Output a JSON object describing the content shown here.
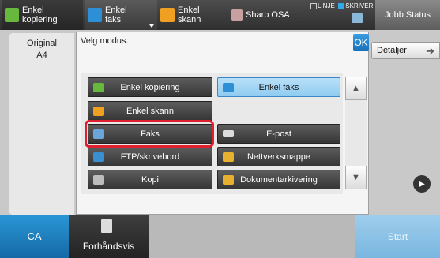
{
  "tabs": [
    {
      "label": "Enkel kopiering",
      "line1": "Enkel",
      "line2": "kopiering",
      "icon": "copy-icon"
    },
    {
      "label": "Enkel faks",
      "line1": "Enkel",
      "line2": "faks",
      "icon": "fax-icon"
    },
    {
      "label": "Enkel skann",
      "line1": "Enkel",
      "line2": "skann",
      "icon": "scan-icon"
    },
    {
      "label": "Sharp OSA",
      "line1": "Sharp OSA",
      "icon": "osa-icon"
    }
  ],
  "status": {
    "line": "LINJE",
    "printer": "SKRIVER"
  },
  "job_status": "Jobb Status",
  "original": {
    "label": "Original",
    "size": "A4"
  },
  "detail_button": "Detaljer",
  "dialog": {
    "title": "Velg modus.",
    "ok": "OK"
  },
  "modes": [
    {
      "label": "Enkel kopiering",
      "icon": "copy-icon"
    },
    {
      "label": "Enkel faks",
      "icon": "fax-icon",
      "selected": true
    },
    {
      "label": "Enkel skann",
      "icon": "scan-icon"
    },
    {
      "label": "Faks",
      "icon": "fax-icon"
    },
    {
      "label": "E-post",
      "icon": "mail-icon"
    },
    {
      "label": "FTP/skrivebord",
      "icon": "desktop-icon"
    },
    {
      "label": "Nettverksmappe",
      "icon": "folder-icon"
    },
    {
      "label": "Kopi",
      "icon": "copy-icon"
    },
    {
      "label": "Dokumentarkivering",
      "icon": "archive-icon"
    }
  ],
  "bottom": {
    "ca": "CA",
    "preview": "Forhåndsvis",
    "start": "Start"
  },
  "colors": {
    "accent": "#1e7fc4",
    "highlight": "#e0202e",
    "selected": "#9fd2f3"
  }
}
